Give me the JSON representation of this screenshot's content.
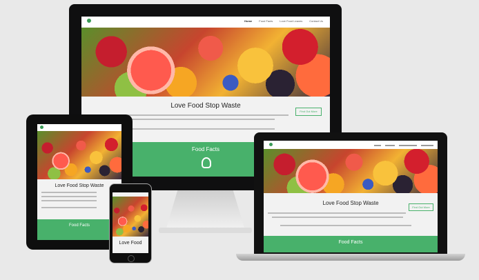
{
  "monitor": {
    "nav": [
      "Home",
      "Food Facts",
      "Love Food Leaves",
      "Contact Us"
    ],
    "hero_title": "Love Food Stop Waste",
    "cta_label": "Find Out More",
    "section_title": "Food Facts"
  },
  "laptop": {
    "hero_title": "Love Food Stop Waste",
    "cta_label": "Find Out More",
    "section_title": "Food Facts"
  },
  "tablet": {
    "hero_title": "Love Food Stop Waste",
    "section_title": "Food Facts"
  },
  "phone": {
    "hero_title": "Love Food"
  }
}
